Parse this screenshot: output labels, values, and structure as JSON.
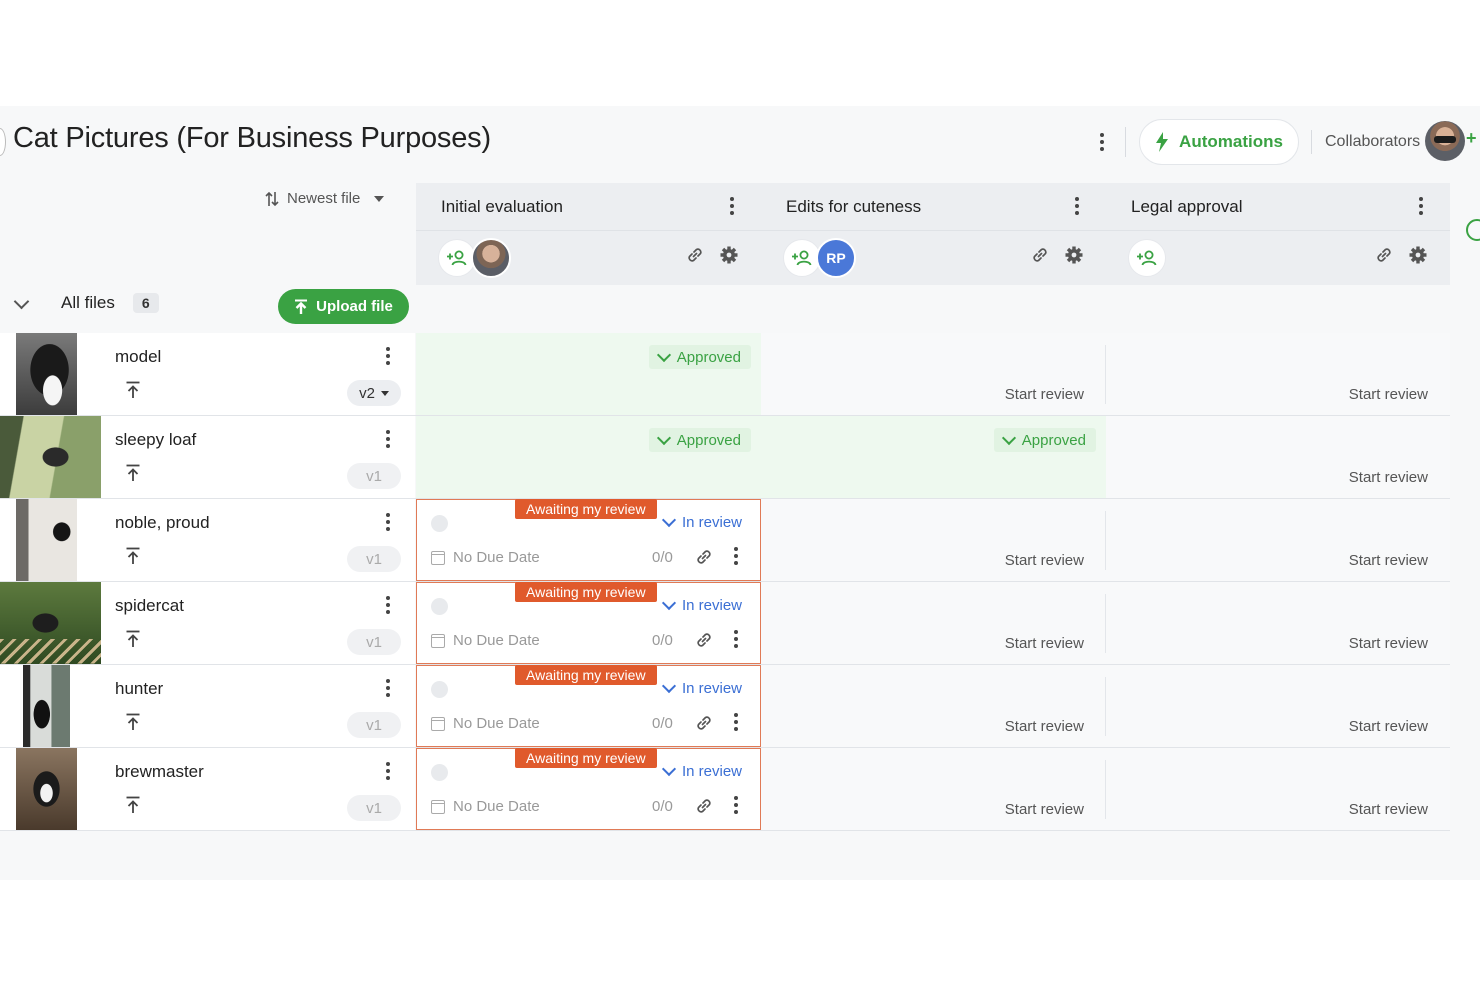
{
  "page": {
    "title": "Cat Pictures (For Business Purposes)",
    "automations_label": "Automations",
    "collaborators_label": "Collaborators",
    "invite_symbol": "+"
  },
  "toolbar": {
    "sort_label": "Newest file",
    "all_files_label": "All files",
    "file_count": "6",
    "upload_label": "Upload file"
  },
  "stages": [
    {
      "name": "Initial evaluation",
      "reviewer": "photo"
    },
    {
      "name": "Edits for cuteness",
      "reviewer": "RP"
    },
    {
      "name": "Legal approval",
      "reviewer": ""
    }
  ],
  "labels": {
    "approved": "Approved",
    "start_review": "Start review",
    "awaiting": "Awaiting my review",
    "in_review": "In review",
    "no_due_date": "No Due Date",
    "ratio": "0/0"
  },
  "files": [
    {
      "name": "model",
      "version": "v2"
    },
    {
      "name": "sleepy loaf",
      "version": "v1"
    },
    {
      "name": "noble, proud",
      "version": "v1"
    },
    {
      "name": "spidercat",
      "version": "v1"
    },
    {
      "name": "hunter",
      "version": "v1"
    },
    {
      "name": "brewmaster",
      "version": "v1"
    }
  ],
  "colors": {
    "accent_green": "#3aa243",
    "awaiting_orange": "#e05a2c",
    "in_review_blue": "#3b6fd4",
    "avatar_blue": "#4a78d8"
  }
}
